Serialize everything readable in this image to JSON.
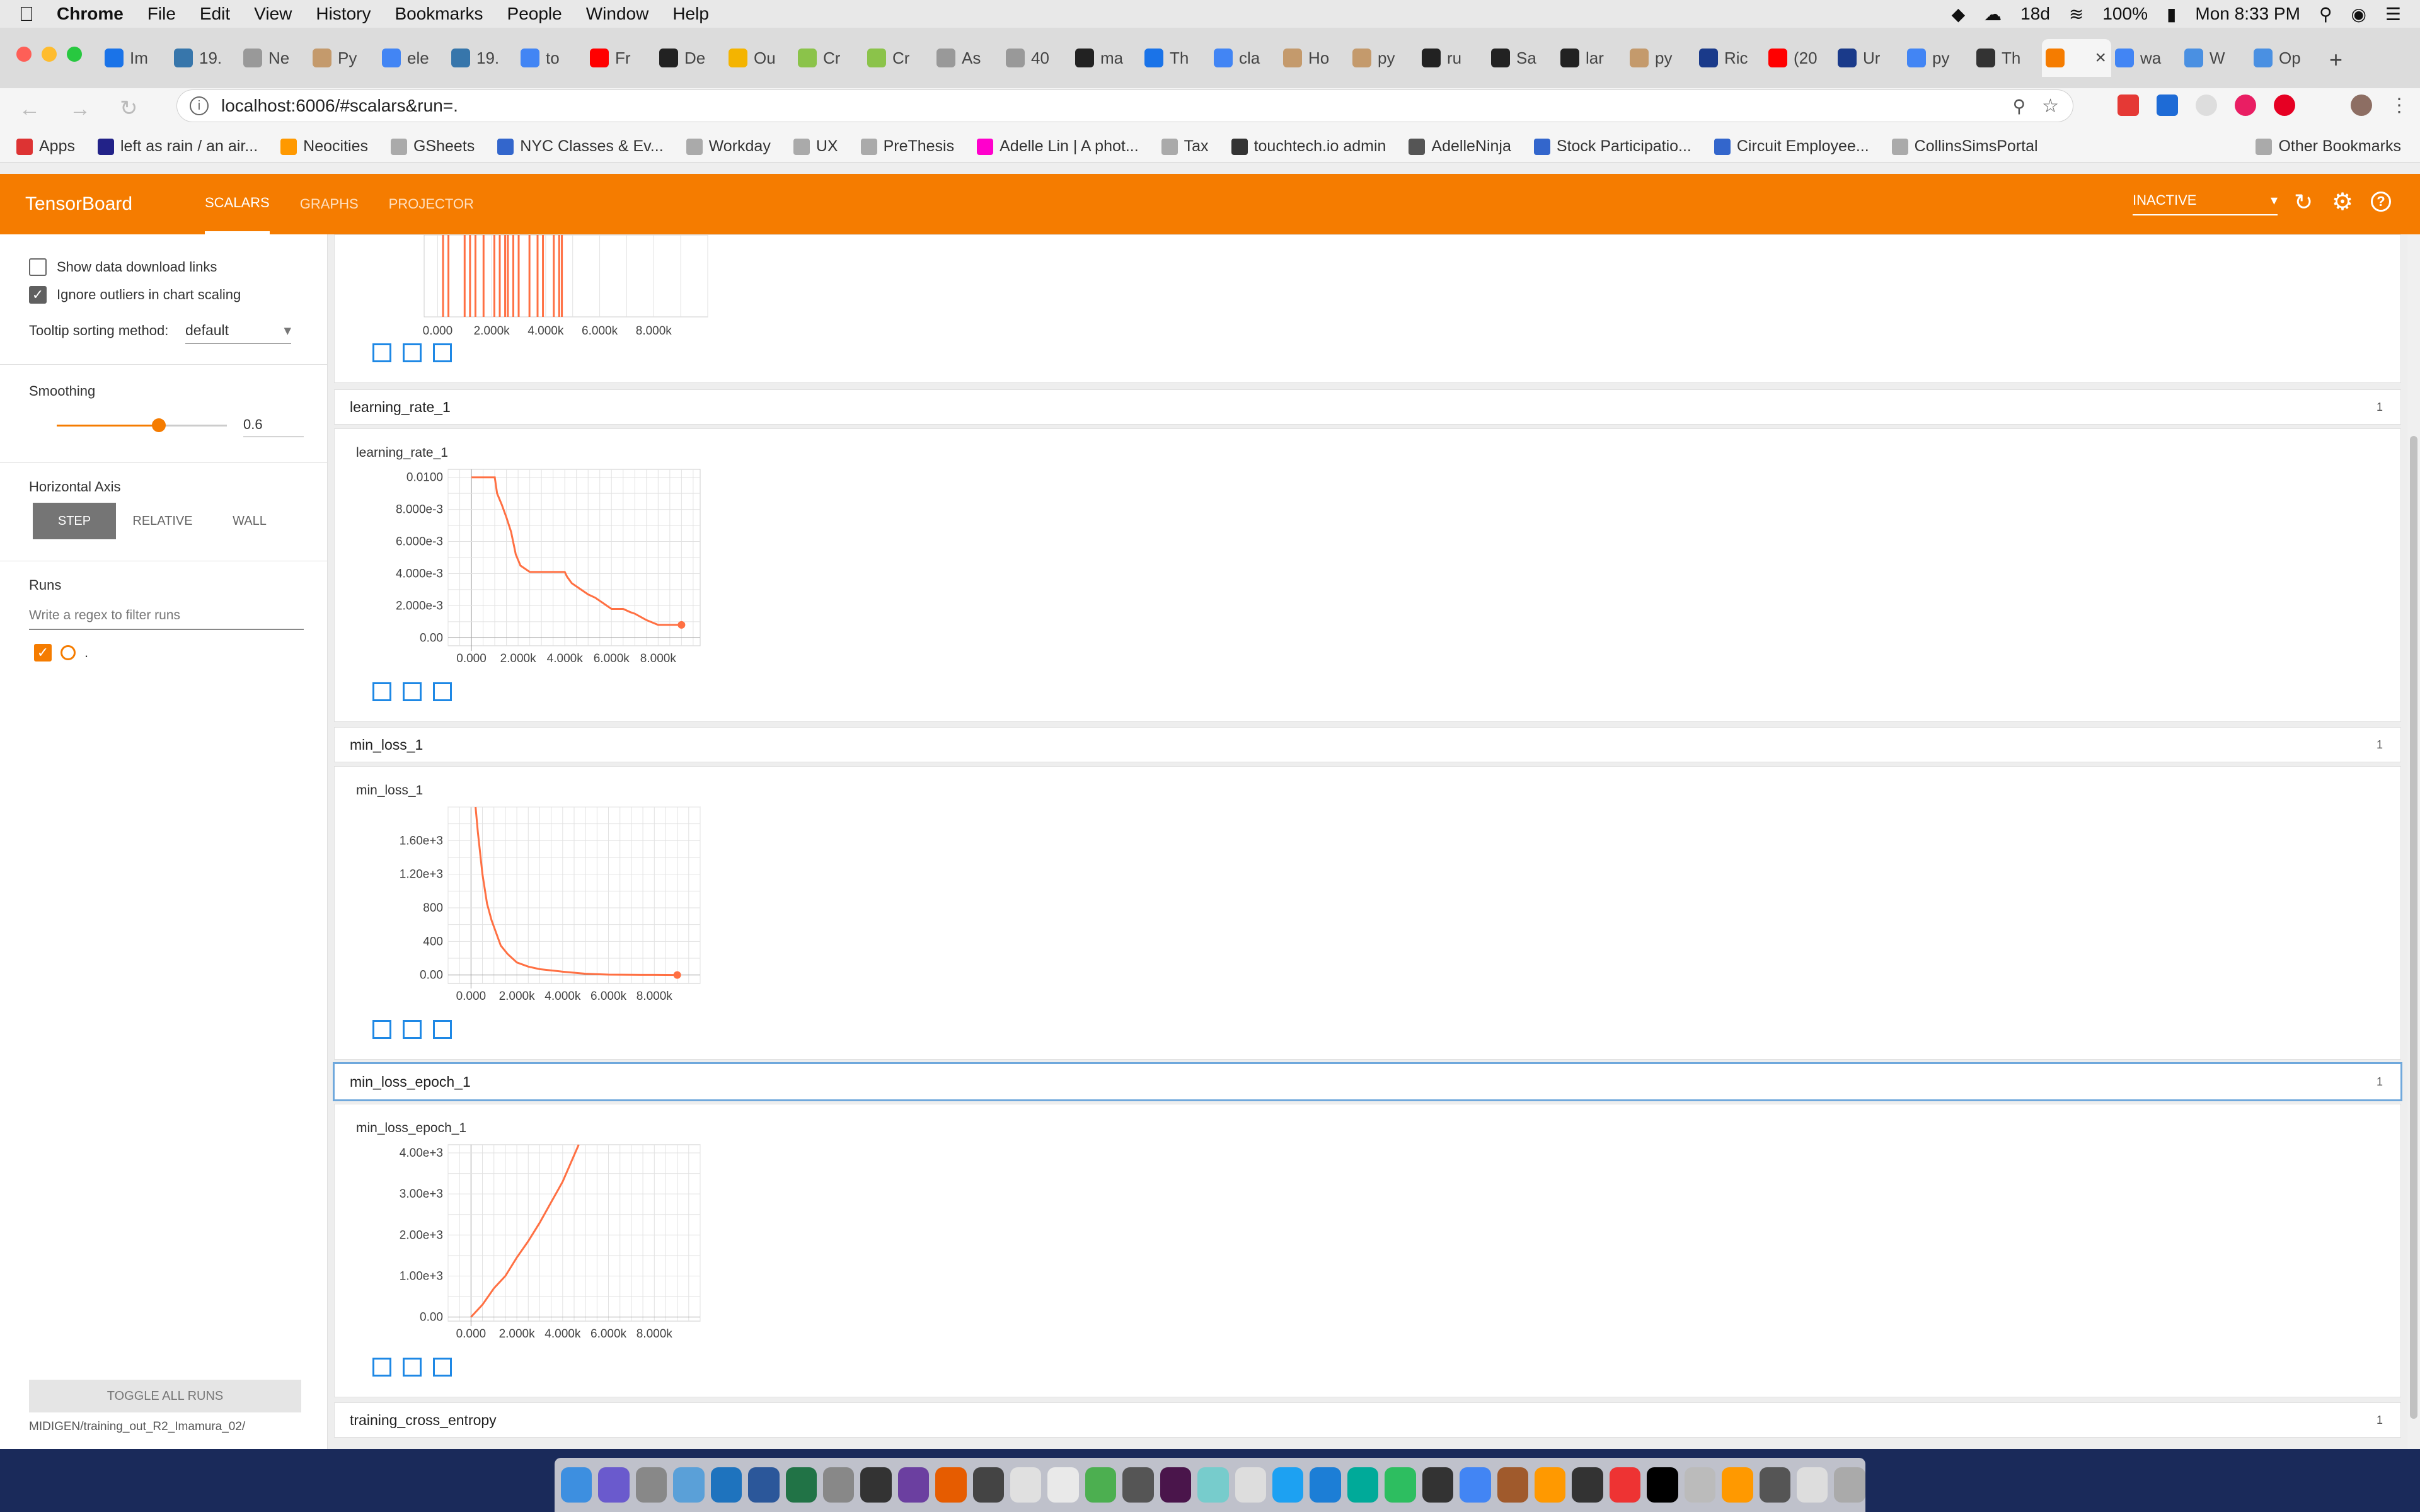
{
  "menubar": {
    "app": "Chrome",
    "items": [
      "File",
      "Edit",
      "View",
      "History",
      "Bookmarks",
      "People",
      "Window",
      "Help"
    ],
    "status": {
      "days": "18d",
      "battery": "100%",
      "clock": "Mon 8:33 PM"
    }
  },
  "tabs": [
    {
      "label": "Im",
      "color": "#1a73e8"
    },
    {
      "label": "19.",
      "color": "#3776ab"
    },
    {
      "label": "Ne",
      "color": "#999"
    },
    {
      "label": "Py",
      "color": "#c49a6c"
    },
    {
      "label": "ele",
      "color": "#4285f4"
    },
    {
      "label": "19.",
      "color": "#3776ab"
    },
    {
      "label": "to",
      "color": "#4285f4"
    },
    {
      "label": "Fr",
      "color": "#ff0000"
    },
    {
      "label": "De",
      "color": "#222"
    },
    {
      "label": "Ou",
      "color": "#f4b400"
    },
    {
      "label": "Cr",
      "color": "#8bc34a"
    },
    {
      "label": "Cr",
      "color": "#8bc34a"
    },
    {
      "label": "As",
      "color": "#999"
    },
    {
      "label": "40",
      "color": "#999"
    },
    {
      "label": "ma",
      "color": "#222"
    },
    {
      "label": "Th",
      "color": "#1a73e8"
    },
    {
      "label": "cla",
      "color": "#4285f4"
    },
    {
      "label": "Ho",
      "color": "#c49a6c"
    },
    {
      "label": "py",
      "color": "#c49a6c"
    },
    {
      "label": "ru",
      "color": "#222"
    },
    {
      "label": "Sa",
      "color": "#222"
    },
    {
      "label": "lar",
      "color": "#222"
    },
    {
      "label": "py",
      "color": "#c49a6c"
    },
    {
      "label": "Ric",
      "color": "#1a3a8a"
    },
    {
      "label": "(20",
      "color": "#ff0000"
    },
    {
      "label": "Ur",
      "color": "#1a3a8a"
    },
    {
      "label": "py",
      "color": "#4285f4"
    },
    {
      "label": "Th",
      "color": "#333"
    },
    {
      "label": "",
      "color": "#f57c00"
    },
    {
      "label": "wa",
      "color": "#4285f4"
    },
    {
      "label": "W",
      "color": "#4a90e2"
    },
    {
      "label": "Op",
      "color": "#4a90e2"
    }
  ],
  "address": {
    "url": "localhost:6006/#scalars&run=."
  },
  "bookmarks": [
    {
      "label": "Apps",
      "color": "#d33"
    },
    {
      "label": "left as rain / an air...",
      "color": "#228"
    },
    {
      "label": "Neocities",
      "color": "#f90"
    },
    {
      "label": "GSheets",
      "color": "#aaa"
    },
    {
      "label": "NYC Classes & Ev...",
      "color": "#36c"
    },
    {
      "label": "Workday",
      "color": "#aaa"
    },
    {
      "label": "UX",
      "color": "#aaa"
    },
    {
      "label": "PreThesis",
      "color": "#aaa"
    },
    {
      "label": "Adelle Lin | A phot...",
      "color": "#f0c"
    },
    {
      "label": "Tax",
      "color": "#aaa"
    },
    {
      "label": "touchtech.io admin",
      "color": "#333"
    },
    {
      "label": "AdelleNinja",
      "color": "#555"
    },
    {
      "label": "Stock Participatio...",
      "color": "#36c"
    },
    {
      "label": "Circuit Employee...",
      "color": "#36c"
    },
    {
      "label": "CollinsSimsPortal",
      "color": "#aaa"
    },
    {
      "label": "Other Bookmarks",
      "color": "#aaa"
    }
  ],
  "tb": {
    "brand": "TensorBoard",
    "nav": [
      "SCALARS",
      "GRAPHS",
      "PROJECTOR"
    ],
    "status": "INACTIVE",
    "accent": "#f57c00"
  },
  "sidebar": {
    "show_download": "Show data download links",
    "ignore_outliers": "Ignore outliers in chart scaling",
    "tooltip_label": "Tooltip sorting method:",
    "tooltip_value": "default",
    "smoothing_label": "Smoothing",
    "smoothing_value": "0.6",
    "smoothing_fraction": 0.6,
    "axis_label": "Horizontal Axis",
    "axis_options": [
      "STEP",
      "RELATIVE",
      "WALL"
    ],
    "runs_label": "Runs",
    "runs_placeholder": "Write a regex to filter runs",
    "run_name": ".",
    "toggle_all": "TOGGLE ALL RUNS",
    "run_path": "MIDIGEN/training_out_R2_Imamura_02/"
  },
  "sections": {
    "s1": {
      "title": "learning_rate_1",
      "count": "1"
    },
    "s2": {
      "title": "min_loss_1",
      "count": "1"
    },
    "s3": {
      "title": "min_loss_epoch_1",
      "count": "1"
    },
    "s4": {
      "title": "training_cross_entropy",
      "count": "1"
    }
  },
  "chart_data": [
    {
      "type": "line",
      "title": "",
      "xlabel": "",
      "ylabel": "",
      "xlim": [
        -500,
        10000
      ],
      "xticks": [
        "0.000",
        "2.000k",
        "4.000k",
        "6.000k",
        "8.000k"
      ],
      "xtick_values": [
        0,
        2000,
        4000,
        6000,
        8000
      ],
      "note_partial": true,
      "series": [
        {
          "values_x": [
            200,
            400,
            1000,
            1200,
            1400,
            1700,
            2100,
            2300,
            2500,
            2600,
            2800,
            3000,
            3400,
            3700,
            3900,
            4300,
            4500,
            4600
          ],
          "values_y": [
            1,
            1,
            1,
            1,
            1,
            1,
            1,
            1,
            1,
            1,
            1,
            1,
            1,
            1,
            1,
            1,
            1,
            1
          ]
        }
      ]
    },
    {
      "type": "line",
      "title": "learning_rate_1",
      "xlabel": "",
      "ylabel": "",
      "xlim": [
        -1000,
        9800
      ],
      "ylim": [
        -0.0005,
        0.0105
      ],
      "xticks": [
        "0.000",
        "2.000k",
        "4.000k",
        "6.000k",
        "8.000k"
      ],
      "xtick_values": [
        0,
        2000,
        4000,
        6000,
        8000
      ],
      "yticks": [
        "0.00",
        "2.000e-3",
        "4.000e-3",
        "6.000e-3",
        "8.000e-3",
        "0.0100"
      ],
      "ytick_values": [
        0,
        0.002,
        0.004,
        0.006,
        0.008,
        0.01
      ],
      "series": [
        {
          "name": ".",
          "x": [
            0,
            1000,
            1100,
            1300,
            1500,
            1700,
            1900,
            2100,
            2500,
            3000,
            3500,
            4000,
            4100,
            4300,
            4600,
            5000,
            5300,
            5600,
            6000,
            6500,
            6800,
            7000,
            7500,
            8000,
            8500,
            9000
          ],
          "y": [
            0.01,
            0.01,
            0.009,
            0.0083,
            0.0075,
            0.0066,
            0.0052,
            0.0045,
            0.0041,
            0.0041,
            0.0041,
            0.0041,
            0.0038,
            0.0034,
            0.0031,
            0.0027,
            0.0025,
            0.0022,
            0.0018,
            0.0018,
            0.0016,
            0.0015,
            0.0011,
            0.0008,
            0.0008,
            0.0008
          ]
        }
      ]
    },
    {
      "type": "line",
      "title": "min_loss_1",
      "xlabel": "",
      "ylabel": "",
      "xlim": [
        -1000,
        10000
      ],
      "ylim": [
        -100,
        2000
      ],
      "xticks": [
        "0.000",
        "2.000k",
        "4.000k",
        "6.000k",
        "8.000k"
      ],
      "xtick_values": [
        0,
        2000,
        4000,
        6000,
        8000
      ],
      "yticks": [
        "0.00",
        "400",
        "800",
        "1.20e+3",
        "1.60e+3"
      ],
      "ytick_values": [
        0,
        400,
        800,
        1200,
        1600
      ],
      "series": [
        {
          "name": ".",
          "x": [
            200,
            300,
            500,
            700,
            900,
            1100,
            1300,
            1600,
            2000,
            2500,
            3000,
            4000,
            5000,
            6000,
            7000,
            8000,
            9000
          ],
          "y": [
            2000,
            1700,
            1200,
            850,
            650,
            500,
            350,
            250,
            150,
            100,
            70,
            40,
            15,
            5,
            3,
            2,
            0
          ]
        }
      ]
    },
    {
      "type": "line",
      "title": "min_loss_epoch_1",
      "xlabel": "",
      "ylabel": "",
      "xlim": [
        -1000,
        10000
      ],
      "ylim": [
        -100,
        4200
      ],
      "xticks": [
        "0.000",
        "2.000k",
        "4.000k",
        "6.000k",
        "8.000k"
      ],
      "xtick_values": [
        0,
        2000,
        4000,
        6000,
        8000
      ],
      "yticks": [
        "0.00",
        "1.00e+3",
        "2.00e+3",
        "3.00e+3",
        "4.00e+3"
      ],
      "ytick_values": [
        0,
        1000,
        2000,
        3000,
        4000
      ],
      "series": [
        {
          "name": ".",
          "x": [
            0,
            500,
            1000,
            1500,
            2000,
            2500,
            3000,
            3500,
            4000,
            4700
          ],
          "y": [
            0,
            300,
            700,
            1000,
            1450,
            1850,
            2300,
            2800,
            3300,
            4200
          ]
        }
      ]
    }
  ]
}
